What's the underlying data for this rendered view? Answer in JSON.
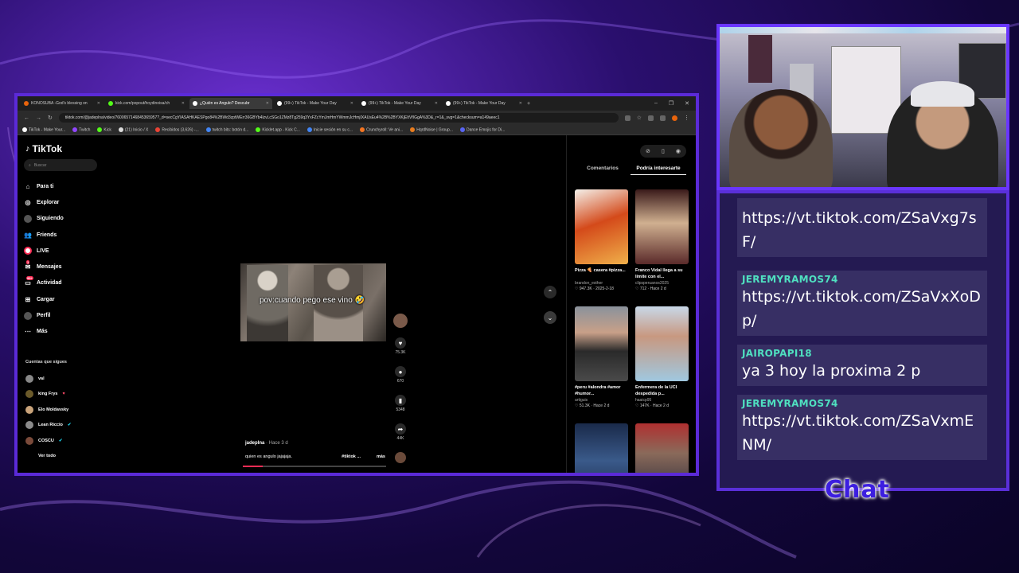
{
  "browser": {
    "tabs": [
      {
        "label": "KONOSUBA -God's blessing on",
        "color": "#e8640c",
        "active": false
      },
      {
        "label": "kick.com/popout/hoydinoisa/ch",
        "color": "#53fc18",
        "active": false
      },
      {
        "label": "¿Quién es Angulo? Descubr",
        "color": "#ffffff",
        "active": true
      },
      {
        "label": "(99+) TikTok - Make Your Day",
        "color": "#ffffff",
        "active": false
      },
      {
        "label": "(99+) TikTok - Make Your Day",
        "color": "#ffffff",
        "active": false
      },
      {
        "label": "(99+) TikTok - Make Your Day",
        "color": "#ffffff",
        "active": false
      }
    ],
    "url": "tiktok.com/@jadeplna/video/7600657146845365957?_d=secCgYIASAHKAESPgo84%2BWd3zptWErr36GBYb4lzvLcSGo1ZMz8Tg259q3YxFZcYmJmHmYWmmJcHmjIXAUsEu4%2B%2BYXKjEItVfIGgA%3D&_r=1&_svg=1&checksum=a149aeec1",
    "bookmarks": [
      "TikTok - Make Your...",
      "Twitch",
      "Kick",
      "(21) Inicio / X",
      "Recibidos (3,626) -...",
      "twitch bits: botón d...",
      "Kicklet.app - Kick C...",
      "Inicie sesión en su c...",
      "Crunchyroll: Ve ani...",
      "HqrdNoise | Group...",
      "Dance Emojis for Di..."
    ]
  },
  "tiktok": {
    "logo": "TikTok",
    "search_placeholder": "Buscar",
    "menu": [
      {
        "label": "Para ti",
        "icon": "home-icon"
      },
      {
        "label": "Explorar",
        "icon": "compass-icon"
      },
      {
        "label": "Siguiendo",
        "icon": "following-icon"
      },
      {
        "label": "Friends",
        "icon": "friends-icon"
      },
      {
        "label": "LIVE",
        "icon": "live-icon"
      },
      {
        "label": "Mensajes",
        "icon": "messages-icon",
        "badge": "1"
      },
      {
        "label": "Actividad",
        "icon": "activity-icon",
        "badge": "99+"
      },
      {
        "label": "Cargar",
        "icon": "upload-icon"
      },
      {
        "label": "Perfil",
        "icon": "profile-icon"
      },
      {
        "label": "Más",
        "icon": "more-icon"
      }
    ],
    "following_title": "Cuentas que sigues",
    "following": [
      {
        "name": "val",
        "emoji": ""
      },
      {
        "name": "king Frys",
        "emoji": "♥"
      },
      {
        "name": "Elo Moldavsky",
        "emoji": ""
      },
      {
        "name": "Lean Riccio",
        "emoji": "✔"
      },
      {
        "name": "COSCU",
        "emoji": "✔"
      }
    ],
    "see_all": "Ver todo",
    "video": {
      "caption": "pov:cuando pego ese vino 🤣",
      "author": "jadeplna",
      "time": "· Hace 3 d",
      "description": "quien es angulo jajajaja.",
      "hashtag": "#tiktok ...",
      "more": "más",
      "progress": 0.14
    },
    "actions": {
      "likes": "75.3K",
      "comments": "670",
      "saves": "5348",
      "shares": "44K"
    },
    "right_tabs": [
      "Comentarios",
      "Podría interesarte"
    ],
    "cards": [
      {
        "title": "Pizza 🍕 casera #pizza...",
        "author": "brandon_esther",
        "stats": "♡ 947.3K · 2025-2-18",
        "c1": "#d44a1a",
        "c2": "#f0b04a"
      },
      {
        "title": "Franco Vidal llega a su límite con el...",
        "author": "clipsperuanos2025",
        "stats": "♡ 712 · Hace 2 d",
        "c1": "#5a2a2a",
        "c2": "#d0b090"
      },
      {
        "title": "#peru #alondra #amor #humor...",
        "author": "artiguis",
        "stats": "♡ 51.3K · Hace 2 d",
        "c1": "#6a7480",
        "c2": "#2a2a2a"
      },
      {
        "title": "Enfermera de la UCI despedida p...",
        "author": "haaicp95",
        "stats": "♡ 147K · Hace 2 d",
        "c1": "#a0c8e0",
        "c2": "#c89880"
      },
      {
        "title": "",
        "author": "",
        "stats": "",
        "c1": "#3a5a8a",
        "c2": "#1a2a4a"
      },
      {
        "title": "",
        "author": "",
        "stats": "",
        "c1": "#b03030",
        "c2": "#2a2a3a"
      }
    ]
  },
  "chat": {
    "messages": [
      {
        "user": "",
        "text": "https://vt.tiktok.com/ZSaVxg7sF/"
      },
      {
        "user": "JEREMYRAMOS74",
        "text": "https://vt.tiktok.com/ZSaVxXoDp/"
      },
      {
        "user": "JAIROPAPI18",
        "text": "ya 3 hoy la proxima 2 p"
      },
      {
        "user": "JEREMYRAMOS74",
        "text": "https://vt.tiktok.com/ZSaVxmENM/"
      }
    ],
    "label": "Chat"
  }
}
